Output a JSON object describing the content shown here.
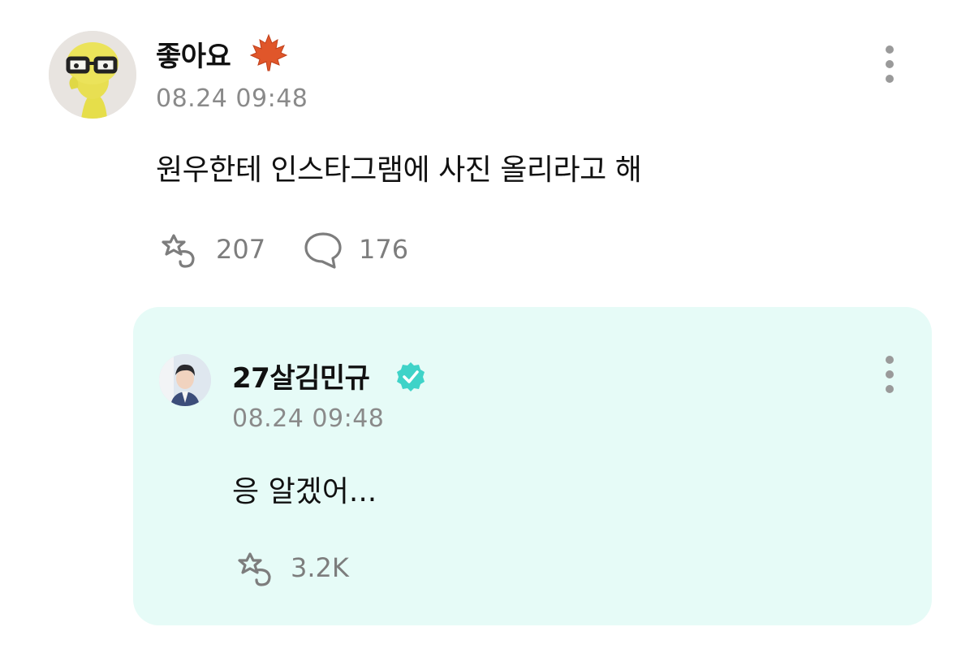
{
  "post": {
    "username": "좋아요",
    "username_emoji": "maple-leaf-icon",
    "timestamp": "08.24 09:48",
    "text": "원우한테 인스타그램에 사진 올리라고 해",
    "reactions_count": "207",
    "comments_count": "176"
  },
  "reply": {
    "username": "27살김민규",
    "verified": true,
    "timestamp": "08.24 09:48",
    "text": "응 알겠어...",
    "reactions_count": "3.2K"
  },
  "colors": {
    "reply_background": "#e6fbf7",
    "verified_badge": "#3fd3c8",
    "muted_text": "#8a8a8a"
  }
}
